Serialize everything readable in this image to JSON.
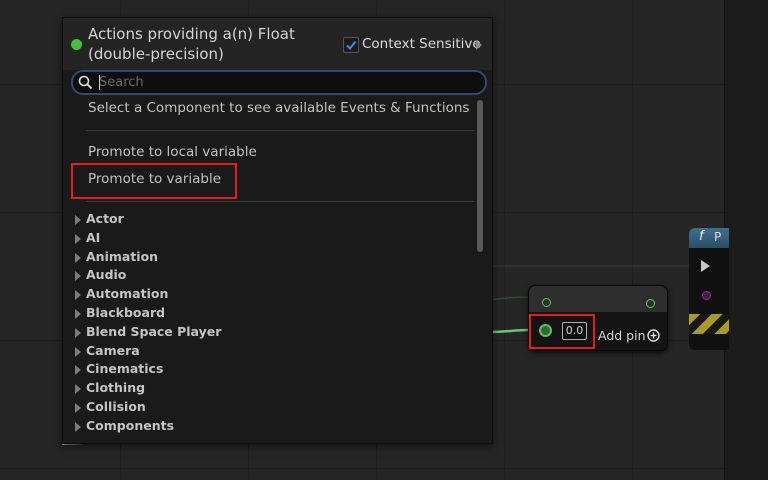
{
  "menu": {
    "title": "Actions providing a(n) Float (double-precision)",
    "context_sensitive": {
      "label": "Context Sensitive",
      "checked": true
    },
    "search": {
      "placeholder": "Search",
      "value": ""
    },
    "info_text": "Select a Component to see available Events & Functions",
    "actions": [
      "Promote to local variable",
      "Promote to variable"
    ],
    "categories": [
      "Actor",
      "AI",
      "Animation",
      "Audio",
      "Automation",
      "Blackboard",
      "Blend Space Player",
      "Camera",
      "Cinematics",
      "Clothing",
      "Collision",
      "Components"
    ]
  },
  "node": {
    "value": "0.0",
    "add_pin_label": "Add pin"
  },
  "function_node": {
    "glyph": "f",
    "title_fragment": "P"
  },
  "colors": {
    "float_pin": "#66b866",
    "highlight": "#e02020",
    "search_border": "#2f4a78",
    "function_header": "#3f6f8e"
  },
  "icons": [
    "search-icon",
    "checkbox-check-icon",
    "chevron-right-icon",
    "expand-triangle-icon",
    "add-pin-icon",
    "function-icon",
    "exec-pin-icon"
  ]
}
